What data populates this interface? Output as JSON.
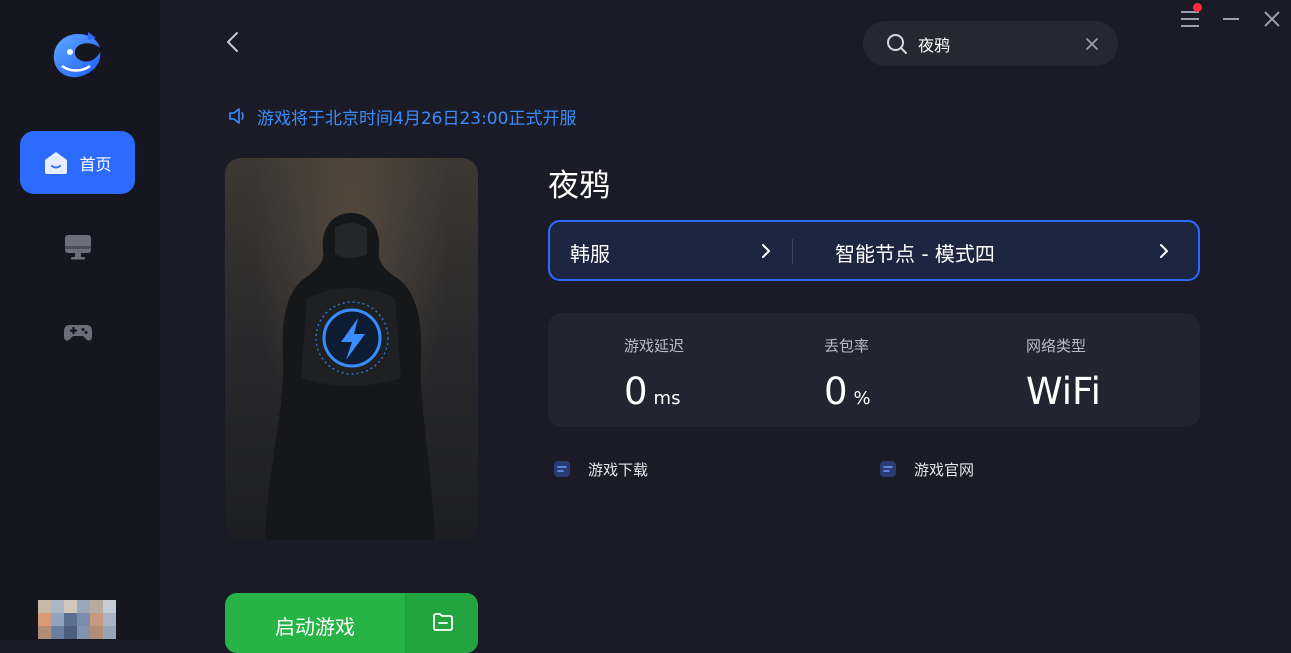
{
  "sidebar": {
    "logo_icon": "dolphin-logo-icon",
    "items": [
      {
        "label": "首页",
        "icon": "home-icon",
        "active": true
      },
      {
        "label": "",
        "icon": "monitor-icon",
        "active": false
      },
      {
        "label": "",
        "icon": "gamepad-icon",
        "active": false
      }
    ]
  },
  "header": {
    "back_icon": "chevron-left-icon",
    "search": {
      "value": "夜鸦",
      "icon": "search-icon",
      "clear_icon": "close-icon"
    },
    "window_controls": [
      "menu-icon",
      "minimize-icon",
      "close-icon"
    ],
    "notification_color": "#ff2b3c"
  },
  "notice": {
    "text": "游戏将于北京时间4月26日23:00正式开服",
    "icon": "speaker-icon"
  },
  "game": {
    "title": "夜鸦",
    "cover_icon": "lightning-boost-icon"
  },
  "server": {
    "region": "韩服",
    "node": "智能节点 - 模式四"
  },
  "stats": [
    {
      "label": "游戏延迟",
      "value": "0",
      "unit": "ms"
    },
    {
      "label": "丢包率",
      "value": "0",
      "unit": "%"
    },
    {
      "label": "网络类型",
      "value": "WiFi",
      "unit": ""
    }
  ],
  "links": [
    {
      "label": "游戏下载",
      "icon": "document-icon"
    },
    {
      "label": "游戏官网",
      "icon": "document-icon"
    }
  ],
  "launch": {
    "label": "启动游戏",
    "folder_icon": "folder-icon"
  },
  "colors": {
    "accent": "#2d6bff",
    "notice": "#3a8dff",
    "launch": "#27b446",
    "background": "#1a1b26",
    "sidebar": "#15161f"
  }
}
